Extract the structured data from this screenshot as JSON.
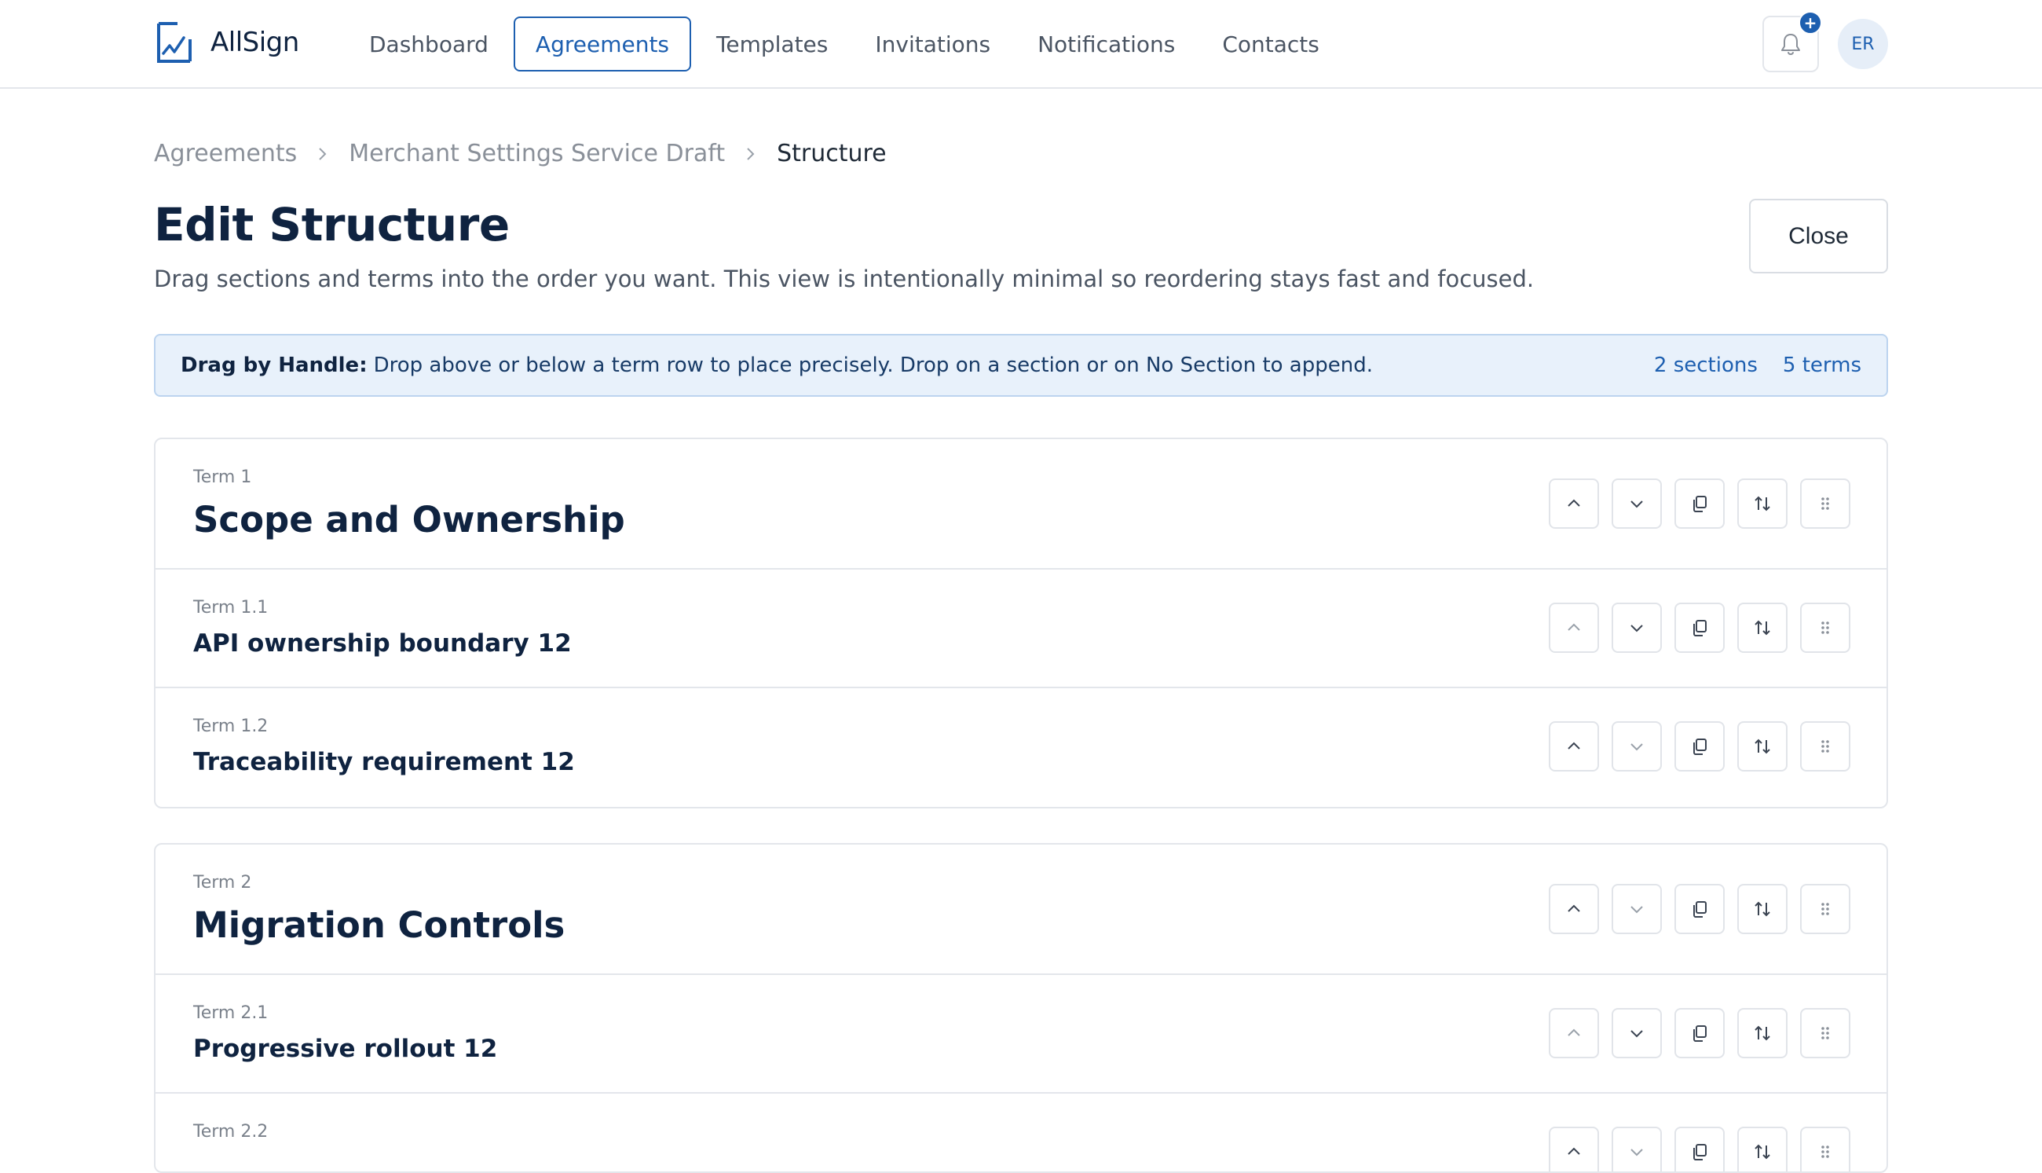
{
  "app": {
    "name": "AllSign"
  },
  "nav": {
    "items": [
      {
        "label": "Dashboard",
        "active": false
      },
      {
        "label": "Agreements",
        "active": true
      },
      {
        "label": "Templates",
        "active": false
      },
      {
        "label": "Invitations",
        "active": false
      },
      {
        "label": "Notifications",
        "active": false
      },
      {
        "label": "Contacts",
        "active": false
      }
    ],
    "bell_badge": "+",
    "avatar_initials": "ER"
  },
  "breadcrumb": [
    "Agreements",
    "Merchant Settings Service Draft",
    "Structure"
  ],
  "header": {
    "title": "Edit Structure",
    "subtitle": "Drag sections and terms into the order you want. This view is intentionally minimal so reordering stays fast and focused.",
    "close_label": "Close"
  },
  "banner": {
    "label": "Drag by Handle:",
    "text": "Drop above or below a term row to place precisely. Drop on a section or on No Section to append.",
    "sections_count": "2 sections",
    "terms_count": "5 terms"
  },
  "sections": [
    {
      "number": "Term 1",
      "title": "Scope and Ownership",
      "terms": [
        {
          "number": "Term 1.1",
          "title": "API ownership boundary 12"
        },
        {
          "number": "Term 1.2",
          "title": "Traceability requirement 12"
        }
      ]
    },
    {
      "number": "Term 2",
      "title": "Migration Controls",
      "terms": [
        {
          "number": "Term 2.1",
          "title": "Progressive rollout 12"
        },
        {
          "number": "Term 2.2",
          "title": ""
        }
      ]
    }
  ],
  "icons": {
    "move_up": "chevron-up-icon",
    "move_down": "chevron-down-icon",
    "duplicate": "copy-icon",
    "reorder": "swap-vertical-icon",
    "drag": "drag-handle-icon"
  },
  "colors": {
    "accent": "#1d5fb0",
    "banner_bg": "#e8f1fb",
    "text": "#0f2340"
  }
}
